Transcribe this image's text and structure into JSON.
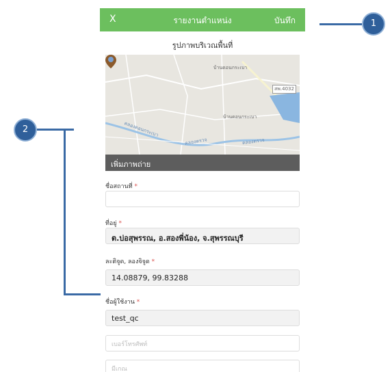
{
  "header": {
    "close_label": "X",
    "title": "รายงานตำแหน่ง",
    "save_label": "บันทึก"
  },
  "map_section": {
    "title": "รูปภาพบริเวณพื้นที่",
    "labels": [
      "บ้านดอนกระเบา",
      "สพ.4032",
      "บ้านดอนกระเบา",
      "คลองดอนกระเบา",
      "คลองตรวจ",
      "คลองตรวจ"
    ],
    "pin_icon": "map-pin-icon",
    "pin_color": "#8b5a2b"
  },
  "add_photo_label": "เพิ่มภาพถ่าย",
  "form": {
    "place_name": {
      "label": "ชื่อสถานที่",
      "required": "*",
      "value": ""
    },
    "address": {
      "label": "ที่อยู่",
      "required": "*",
      "value": "ต.บ่อสุพรรณ, อ.สองพี่น้อง, จ.สุพรรณบุรี"
    },
    "latlng": {
      "label": "ละติจูด, ลองจิจูด",
      "required": "*",
      "value": "14.08879, 99.83288"
    },
    "username": {
      "label": "ชื่อผู้ใช้งาน",
      "required": "*",
      "value": "test_qc"
    },
    "phone": {
      "placeholder": "เบอร์โทรศัพท์"
    },
    "note": {
      "placeholder": "มีเกณ"
    }
  },
  "callouts": [
    "1",
    "2"
  ],
  "colors": {
    "header": "#6cbf5e",
    "callout": "#2f5f9a",
    "addphoto_bar": "#5d5d5d"
  }
}
